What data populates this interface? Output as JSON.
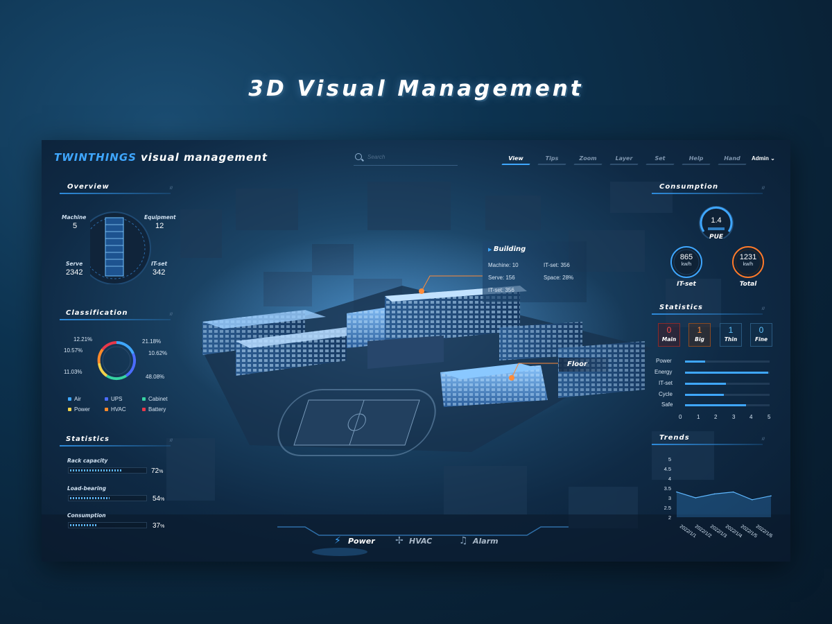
{
  "page_title": "3D Visual Management",
  "header": {
    "brand_prefix": "TWINTHINGS",
    "brand_suffix": "visual management",
    "search_placeholder": "Search",
    "nav": [
      "View",
      "Tips",
      "Zoom",
      "Layer",
      "Set",
      "Help",
      "Hand"
    ],
    "active_tab": "View",
    "user": "Admin",
    "user_icon": "chevron-down-icon"
  },
  "overview": {
    "title": "Overview",
    "machine_label": "Machine",
    "machine_value": "5",
    "equipment_label": "Equipment",
    "equipment_value": "12",
    "serve_label": "Serve",
    "serve_value": "2342",
    "itset_label": "IT-set",
    "itset_value": "342"
  },
  "classification": {
    "title": "Classification",
    "percentages": {
      "p1": "12.21%",
      "p2": "21.18%",
      "p3": "10.57%",
      "p4": "10.62%",
      "p5": "11.03%",
      "p6": "48.08%"
    },
    "legend": [
      {
        "name": "Air",
        "color": "#3fa7ff"
      },
      {
        "name": "UPS",
        "color": "#4b6cff"
      },
      {
        "name": "Cabinet",
        "color": "#36d3a2"
      },
      {
        "name": "Power",
        "color": "#f2d24a"
      },
      {
        "name": "HVAC",
        "color": "#ff8a2a"
      },
      {
        "name": "Battery",
        "color": "#e8384a"
      }
    ]
  },
  "left_statistics": {
    "title": "Statistics",
    "items": [
      {
        "label": "Rack capacity",
        "value": "72",
        "unit": "%",
        "fraction": 0.72
      },
      {
        "label": "Load-bearing",
        "value": "54",
        "unit": "%",
        "fraction": 0.54
      },
      {
        "label": "Consumption",
        "value": "37",
        "unit": "%",
        "fraction": 0.37
      }
    ]
  },
  "building_popup": {
    "title": "Building",
    "machine_label": "Machine:",
    "machine_value": "10",
    "itset1_label": "IT-set:",
    "itset1_value": "356",
    "serve_label": "Serve:",
    "serve_value": "156",
    "space_label": "Space:",
    "space_value": "28%",
    "itset2_label": "IT-set:",
    "itset2_value": "356"
  },
  "floor_label": "Floor",
  "consumption": {
    "title": "Consumption",
    "pue_value": "1.4",
    "pue_label": "PUE",
    "pue_color": "#3fa7ff",
    "itset_value": "865",
    "itset_unit": "kw/h",
    "itset_label": "IT-set",
    "itset_color": "#3fa7ff",
    "total_value": "1231",
    "total_unit": "kw/h",
    "total_label": "Total",
    "total_color": "#ff7a2a"
  },
  "right_statistics": {
    "title": "Statistics",
    "counts": [
      {
        "value": "0",
        "label": "Main",
        "color": "#ff4a4a"
      },
      {
        "value": "1",
        "label": "Big",
        "color": "#ff8a3a"
      },
      {
        "value": "1",
        "label": "Thin",
        "color": "#5fc4ff"
      },
      {
        "value": "0",
        "label": "Fine",
        "color": "#5fc4ff"
      }
    ],
    "bars": [
      {
        "label": "Power",
        "value": 1.2
      },
      {
        "label": "Energy",
        "value": 4.9
      },
      {
        "label": "IT-set",
        "value": 2.4
      },
      {
        "label": "Cycle",
        "value": 2.3
      },
      {
        "label": "Safe",
        "value": 3.6
      }
    ],
    "axis_ticks": [
      "0",
      "1",
      "2",
      "3",
      "4",
      "5"
    ]
  },
  "chart_data": {
    "type": "area",
    "title": "Trends",
    "x": [
      "2022/1/1",
      "2022/1/2",
      "2022/1/3",
      "2022/1/4",
      "2022/1/5",
      "2022/1/6"
    ],
    "values": [
      3.3,
      3.0,
      3.2,
      3.3,
      2.9,
      3.1
    ],
    "y_ticks": [
      "5",
      "4.5",
      "4",
      "3.5",
      "3",
      "2.5",
      "2"
    ],
    "ylim": [
      2,
      5
    ]
  },
  "dock": {
    "items": [
      {
        "label": "Power",
        "icon": "lightning-icon"
      },
      {
        "label": "HVAC",
        "icon": "fan-icon"
      },
      {
        "label": "Alarm",
        "icon": "bell-icon"
      }
    ],
    "active": "Power"
  }
}
